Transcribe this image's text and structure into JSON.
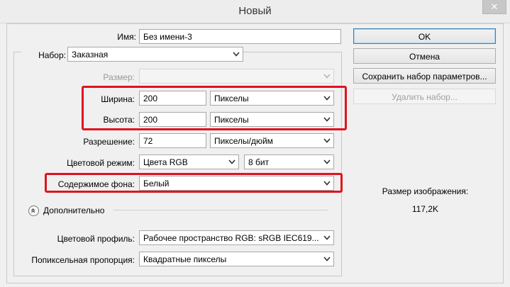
{
  "window": {
    "title": "Новый",
    "close_glyph": "✕"
  },
  "form": {
    "name": {
      "label": "Имя:",
      "value": "Без имени-3"
    },
    "preset": {
      "label": "Набор:",
      "value": "Заказная"
    },
    "size": {
      "label": "Размер:",
      "value": ""
    },
    "width": {
      "label": "Ширина:",
      "value": "200",
      "unit": "Пикселы"
    },
    "height": {
      "label": "Высота:",
      "value": "200",
      "unit": "Пикселы"
    },
    "resolution": {
      "label": "Разрешение:",
      "value": "72",
      "unit": "Пикселы/дюйм"
    },
    "color_mode": {
      "label": "Цветовой режим:",
      "value": "Цвета RGB",
      "depth": "8 бит"
    },
    "background": {
      "label": "Содержимое фона:",
      "value": "Белый"
    },
    "advanced": {
      "label": "Дополнительно"
    },
    "color_profile": {
      "label": "Цветовой профиль:",
      "value": "Рабочее пространство RGB:  sRGB IEC619..."
    },
    "pixel_aspect": {
      "label": "Попиксельная пропорция:",
      "value": "Квадратные пикселы"
    }
  },
  "buttons": {
    "ok": "OK",
    "cancel": "Отмена",
    "save_preset": "Сохранить набор параметров...",
    "delete_preset": "Удалить набор..."
  },
  "image_size": {
    "label": "Размер изображения:",
    "value": "117,2K"
  },
  "icons": {
    "chevron": "chevron-down-icon",
    "advanced": "collapse-chevrons-up-icon",
    "close": "close-icon"
  },
  "colors": {
    "highlight": "#e0131f",
    "primary_button_border": "#3c7fb1"
  }
}
